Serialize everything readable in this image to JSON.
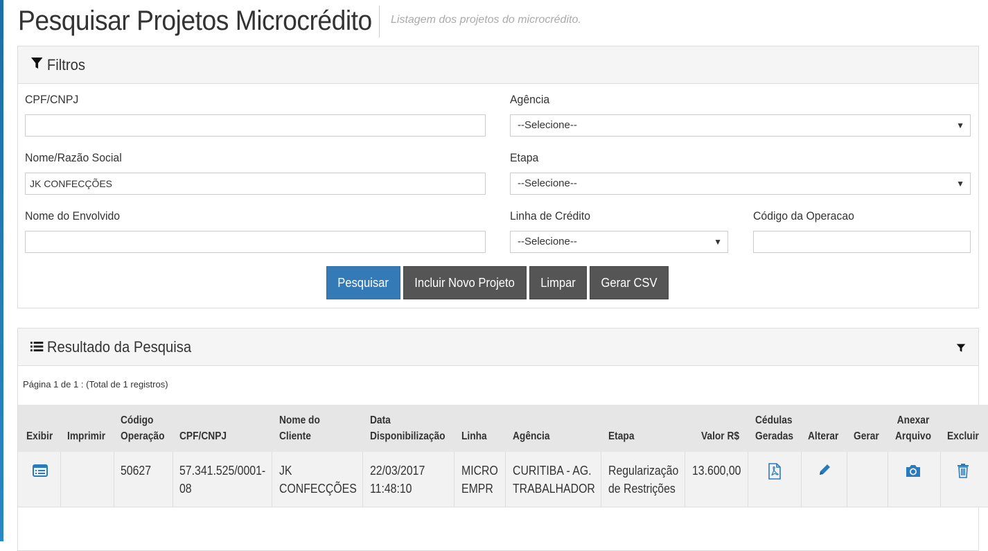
{
  "header": {
    "title": "Pesquisar Projetos Microcrédito",
    "subtitle": "Listagem dos projetos do microcrédito."
  },
  "filters": {
    "panel_title": "Filtros",
    "cpf_label": "CPF/CNPJ",
    "cpf_value": "",
    "agencia_label": "Agência",
    "agencia_value": "--Selecione--",
    "nome_label": "Nome/Razão Social",
    "nome_value": "JK CONFECÇÕES",
    "etapa_label": "Etapa",
    "etapa_value": "--Selecione--",
    "envolvido_label": "Nome do Envolvido",
    "envolvido_value": "",
    "linha_label": "Linha de Crédito",
    "linha_value": "--Selecione--",
    "codigo_label": "Código da Operacao",
    "codigo_value": ""
  },
  "buttons": {
    "pesquisar": "Pesquisar",
    "incluir": "Incluir Novo Projeto",
    "limpar": "Limpar",
    "csv": "Gerar CSV"
  },
  "results": {
    "panel_title": "Resultado da Pesquisa",
    "pager": "Página 1 de 1 : (Total de 1 registros)",
    "columns": {
      "exibir": "Exibir",
      "imprimir": "Imprimir",
      "codigo_1": "Código",
      "codigo_2": "Operação",
      "cpf": "CPF/CNPJ",
      "nome_1": "Nome do",
      "nome_2": "Cliente",
      "data_1": "Data",
      "data_2": "Disponibilização",
      "linha": "Linha",
      "agencia": "Agência",
      "etapa": "Etapa",
      "valor": "Valor R$",
      "cedulas_1": "Cédulas",
      "cedulas_2": "Geradas",
      "alterar": "Alterar",
      "gerar": "Gerar",
      "anexar_1": "Anexar",
      "anexar_2": "Arquivo",
      "excluir": "Excluir"
    },
    "rows": [
      {
        "codigo": "50627",
        "cpf_1": "57.341.525/0001-",
        "cpf_2": "08",
        "nome_1": "JK",
        "nome_2": "CONFECÇÕES",
        "data_1": "22/03/2017",
        "data_2": "11:48:10",
        "linha_1": "MICRO",
        "linha_2": "EMPR",
        "agencia_1": "CURITIBA - AG.",
        "agencia_2": "TRABALHADOR",
        "etapa_1": "Regularização",
        "etapa_2": "de Restrições",
        "valor": "13.600,00"
      }
    ]
  },
  "icons": {
    "filter": "filter-icon",
    "list": "list-icon",
    "exibir": "document-list-icon",
    "pdf": "pdf-icon",
    "edit": "pencil-icon",
    "camera": "camera-icon",
    "delete": "trash-icon"
  },
  "colors": {
    "primary": "#337ab7",
    "dark_button": "#555555",
    "icon_blue": "#2a7bbd"
  }
}
